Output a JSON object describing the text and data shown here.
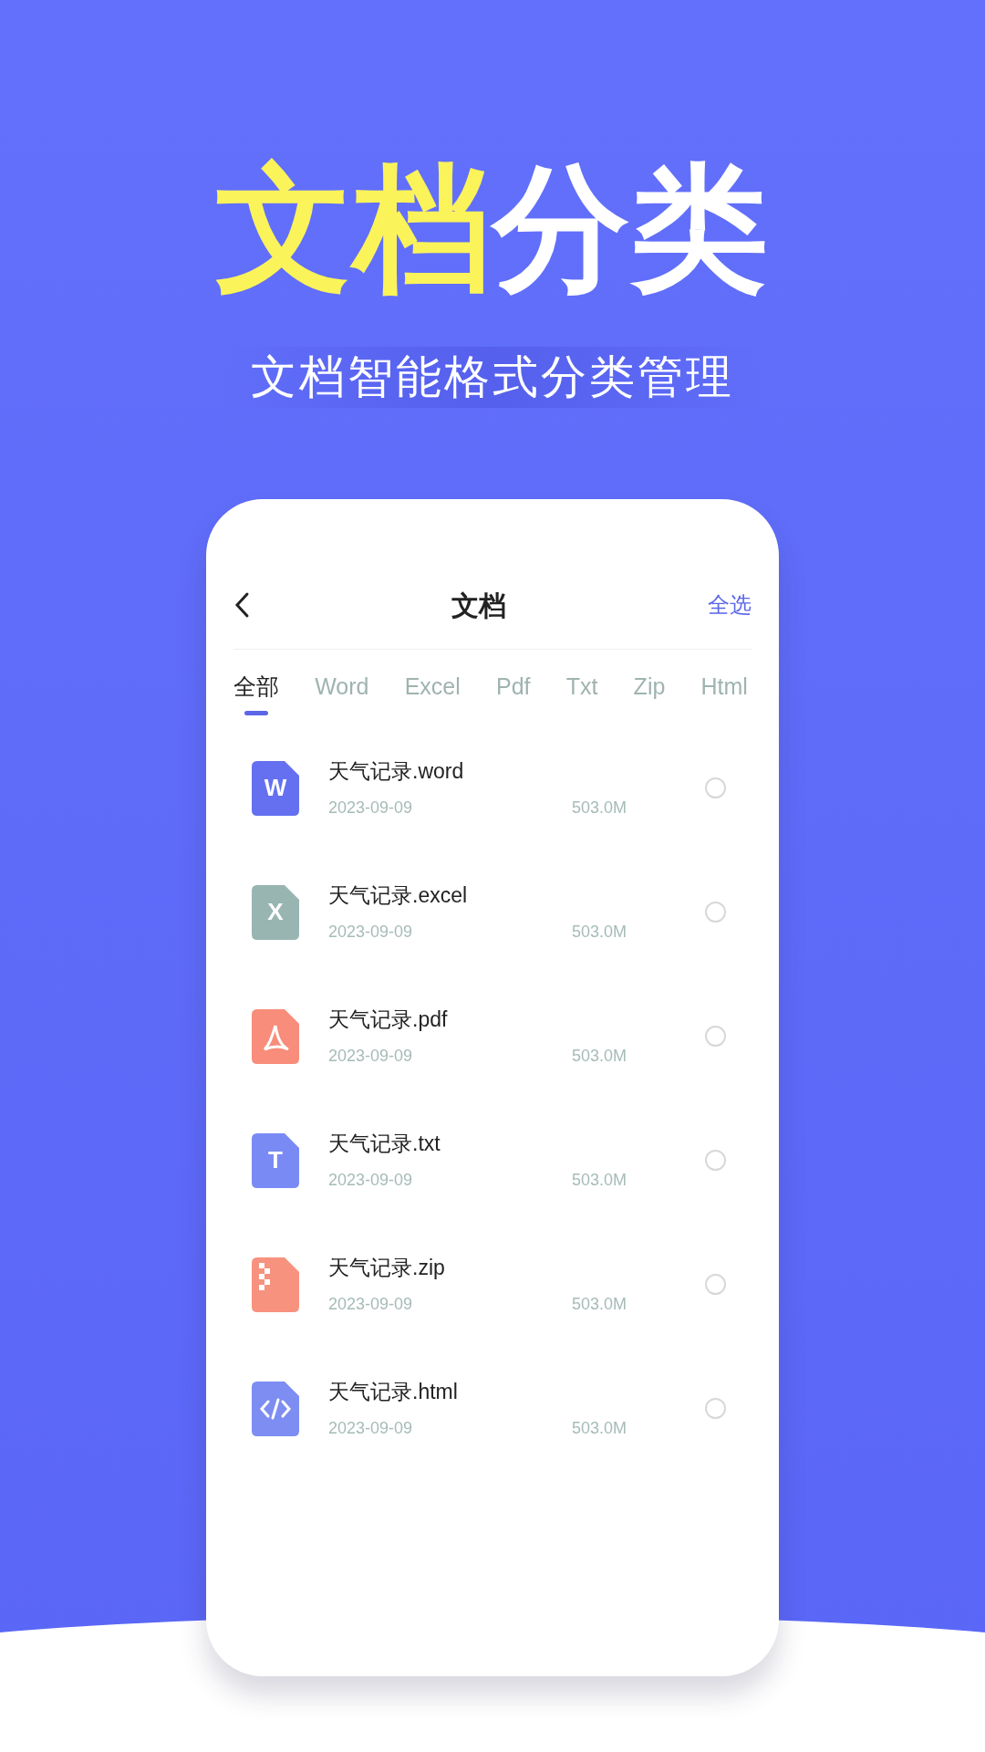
{
  "headline": {
    "highlight": "文档",
    "rest": "分类"
  },
  "subtitle": "文档智能格式分类管理",
  "screen": {
    "title": "文档",
    "select_all": "全选",
    "tabs": [
      {
        "label": "全部",
        "selected": true
      },
      {
        "label": "Word",
        "selected": false
      },
      {
        "label": "Excel",
        "selected": false
      },
      {
        "label": "Pdf",
        "selected": false
      },
      {
        "label": "Txt",
        "selected": false
      },
      {
        "label": "Zip",
        "selected": false
      },
      {
        "label": "Html",
        "selected": false
      }
    ],
    "files": [
      {
        "kind": "letter",
        "letter": "W",
        "color": "#6470f0",
        "name": "天气记录.word",
        "date": "2023-09-09",
        "size": "503.0M",
        "selected": false
      },
      {
        "kind": "letter",
        "letter": "X",
        "color": "#98b5b2",
        "name": "天气记录.excel",
        "date": "2023-09-09",
        "size": "503.0M",
        "selected": false
      },
      {
        "kind": "pdf",
        "color": "#f78d7a",
        "name": "天气记录.pdf",
        "date": "2023-09-09",
        "size": "503.0M",
        "selected": false
      },
      {
        "kind": "letter",
        "letter": "T",
        "color": "#7a8af5",
        "name": "天气记录.txt",
        "date": "2023-09-09",
        "size": "503.0M",
        "selected": false
      },
      {
        "kind": "zip",
        "color": "#f7927e",
        "name": "天气记录.zip",
        "date": "2023-09-09",
        "size": "503.0M",
        "selected": false
      },
      {
        "kind": "code",
        "color": "#7d8df2",
        "name": "天气记录.html",
        "date": "2023-09-09",
        "size": "503.0M",
        "selected": false
      }
    ]
  }
}
